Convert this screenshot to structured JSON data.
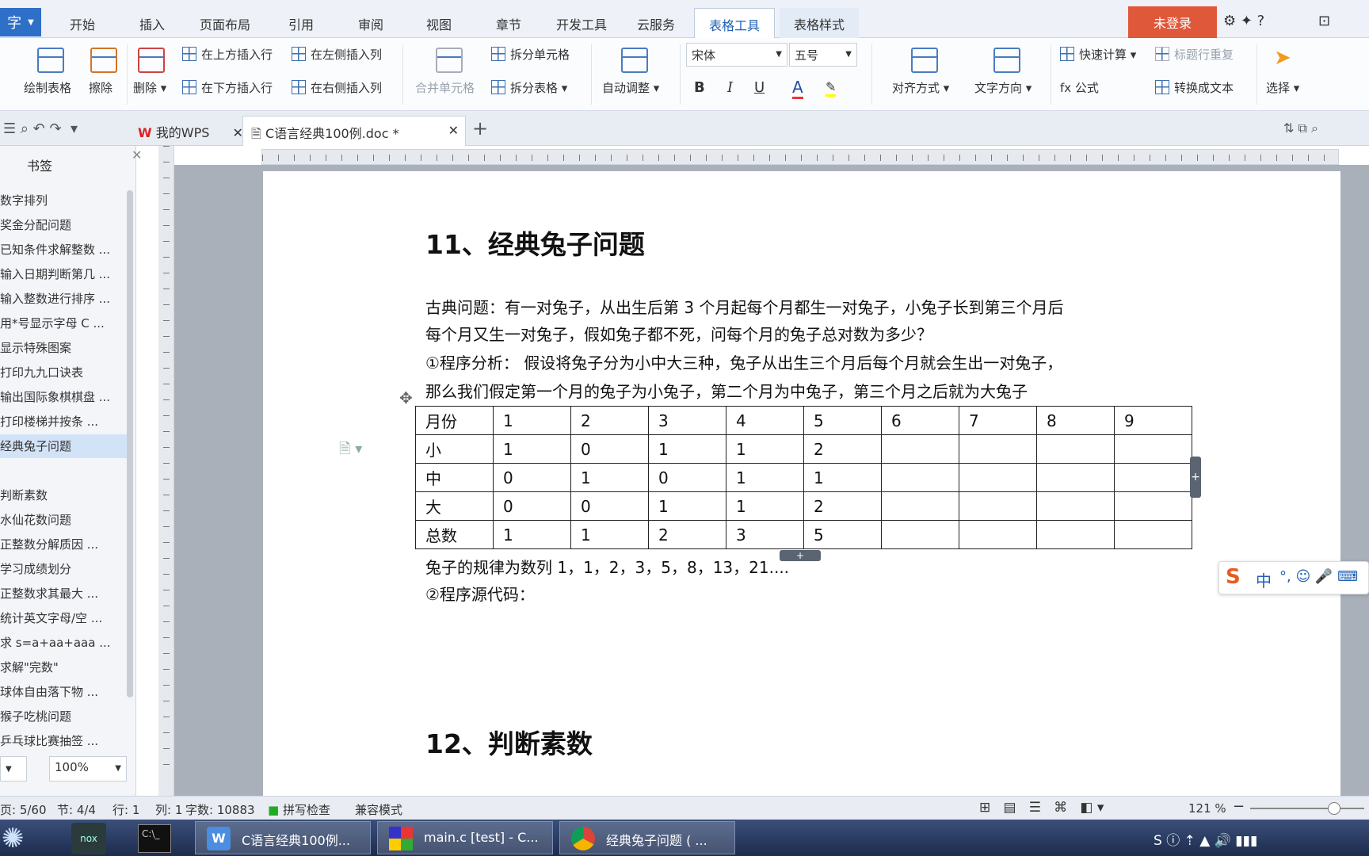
{
  "menubar": {
    "app_label": "字",
    "tabs": [
      "开始",
      "插入",
      "页面布局",
      "引用",
      "审阅",
      "视图",
      "章节",
      "开发工具",
      "云服务",
      "表格工具",
      "表格样式"
    ],
    "login": "未登录"
  },
  "ribbon": {
    "draw_table": "绘制表格",
    "erase": "擦除",
    "delete": "删除",
    "insert_row_above": "在上方插入行",
    "insert_row_below": "在下方插入行",
    "insert_col_left": "在左侧插入列",
    "insert_col_right": "在右侧插入列",
    "merge_cells": "合并单元格",
    "split_cells": "拆分单元格",
    "split_table": "拆分表格",
    "auto_fit": "自动调整",
    "font_name": "宋体",
    "font_size": "五号",
    "align": "对齐方式",
    "text_direction": "文字方向",
    "quick_calc": "快速计算",
    "header_repeat": "标题行重复",
    "formula": "fx 公式",
    "convert_text": "转换成文本",
    "select": "选择",
    "bold": "B",
    "italic": "I",
    "underline": "U",
    "font_color": "A"
  },
  "doctabs": {
    "my_wps": "我的WPS",
    "doc": "C语言经典100例.doc *"
  },
  "sidebar": {
    "title": "书签",
    "zoom": "100%",
    "items": [
      "数字排列",
      "奖金分配问题",
      "已知条件求解整数 ...",
      "输入日期判断第几 ...",
      "输入整数进行排序 ...",
      "用*号显示字母 C ...",
      "显示特殊图案",
      "打印九九口诀表",
      "输出国际象棋棋盘 ...",
      "打印楼梯并按条 ...",
      "经典兔子问题",
      "",
      "判断素数",
      "水仙花数问题",
      "正整数分解质因 ...",
      "学习成绩划分",
      "正整数求其最大 ...",
      "统计英文字母/空 ...",
      "求 s=a+aa+aaa ...",
      "求解\"完数\"",
      "球体自由落下物 ...",
      "猴子吃桃问题",
      "乒乓球比赛抽签 ..."
    ]
  },
  "doc": {
    "h11": "11、经典兔子问题",
    "p1": "古典问题：有一对兔子，从出生后第 3 个月起每个月都生一对兔子，小兔子长到第三个月后",
    "p2": "每个月又生一对兔子，假如兔子都不死，问每个月的兔子总对数为多少？",
    "p3": "①程序分析：  假设将兔子分为小中大三种，兔子从出生三个月后每个月就会生出一对兔子，",
    "p4": "那么我们假定第一个月的兔子为小兔子，第二个月为中兔子，第三个月之后就为大兔子",
    "p5": "兔子的规律为数列 1，1，2，3，5，8，13，21....",
    "p6": "②程序源代码：",
    "h12": "12、判断素数",
    "table": [
      [
        "月份",
        "1",
        "2",
        "3",
        "4",
        "5",
        "6",
        "7",
        "8",
        "9"
      ],
      [
        "小",
        "1",
        "0",
        "1",
        "1",
        "2",
        "",
        "",
        "",
        ""
      ],
      [
        "中",
        "0",
        "1",
        "0",
        "1",
        "1",
        "",
        "",
        "",
        ""
      ],
      [
        "大",
        "0",
        "0",
        "1",
        "1",
        "2",
        "",
        "",
        "",
        ""
      ],
      [
        "总数",
        "1",
        "1",
        "2",
        "3",
        "5",
        "",
        "",
        "",
        ""
      ]
    ]
  },
  "status": {
    "page": "页: 5/60",
    "section": "节: 4/4",
    "row": "行: 1",
    "col": "列: 1",
    "words": "字数: 10883",
    "spell": "拼写检查",
    "compat": "兼容模式",
    "zoom": "121 %"
  },
  "taskbar": {
    "t1": "C语言经典100例...",
    "t2": "main.c [test] - C...",
    "t3": "经典兔子问题 ( ..."
  },
  "ime": {
    "label": "中"
  }
}
